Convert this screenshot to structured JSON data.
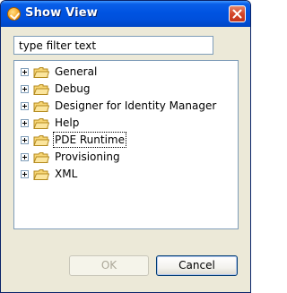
{
  "window": {
    "title": "Show View"
  },
  "filter": {
    "value": "type filter text"
  },
  "tree": {
    "items": [
      {
        "label": "General"
      },
      {
        "label": "Debug"
      },
      {
        "label": "Designer for Identity Manager"
      },
      {
        "label": "Help"
      },
      {
        "label": "PDE Runtime"
      },
      {
        "label": "Provisioning"
      },
      {
        "label": "XML"
      }
    ]
  },
  "buttons": {
    "ok_label": "OK",
    "cancel_label": "Cancel"
  },
  "colors": {
    "titlebar": "#0053e1",
    "dialog_background": "#ece9d8",
    "field_border": "#7f9db9",
    "folder_fill": "#f7d675"
  },
  "icons": {
    "title": "show-view-icon",
    "close": "close-icon",
    "expander": "plus-expander-icon",
    "folder": "folder-icon"
  }
}
